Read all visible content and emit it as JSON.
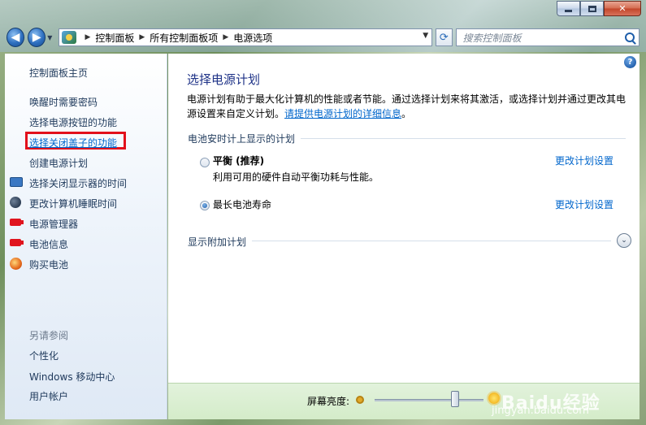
{
  "window": {
    "caption_buttons": [
      "minimize",
      "maximize",
      "close"
    ]
  },
  "navbar": {
    "back_icon": "back-arrow-icon",
    "forward_icon": "forward-arrow-icon",
    "breadcrumbs": [
      "控制面板",
      "所有控制面板项",
      "电源选项"
    ],
    "search_placeholder": "搜索控制面板"
  },
  "sidebar": {
    "home": "控制面板主页",
    "links": [
      "唤醒时需要密码",
      "选择电源按钮的功能",
      "选择关闭盖子的功能",
      "创建电源计划",
      "选择关闭显示器的时间",
      "更改计算机睡眠时间",
      "电源管理器",
      "电池信息",
      "购买电池"
    ],
    "see_also": "另请参阅",
    "see_also_links": [
      "个性化",
      "Windows 移动中心",
      "用户帐户"
    ]
  },
  "main": {
    "title": "选择电源计划",
    "description": "电源计划有助于最大化计算机的性能或者节能。通过选择计划来将其激活，或选择计划并通过更改其电源设置来自定义计划。",
    "description_link": "请提供电源计划的详细信息",
    "description_end": "。",
    "section_title": "电池安时计上显示的计划",
    "plans": [
      {
        "name": "平衡 (推荐)",
        "subtitle": "利用可用的硬件自动平衡功耗与性能。",
        "change_link": "更改计划设置",
        "selected": false
      },
      {
        "name": "最长电池寿命",
        "subtitle": "",
        "change_link": "更改计划设置",
        "selected": true
      }
    ],
    "show_more": "显示附加计划"
  },
  "bottom": {
    "brightness_label": "屏幕亮度:",
    "brightness_fraction": 0.74,
    "watermark": "Baidu经验",
    "watermark_url": "jingyan.baidu.com"
  }
}
